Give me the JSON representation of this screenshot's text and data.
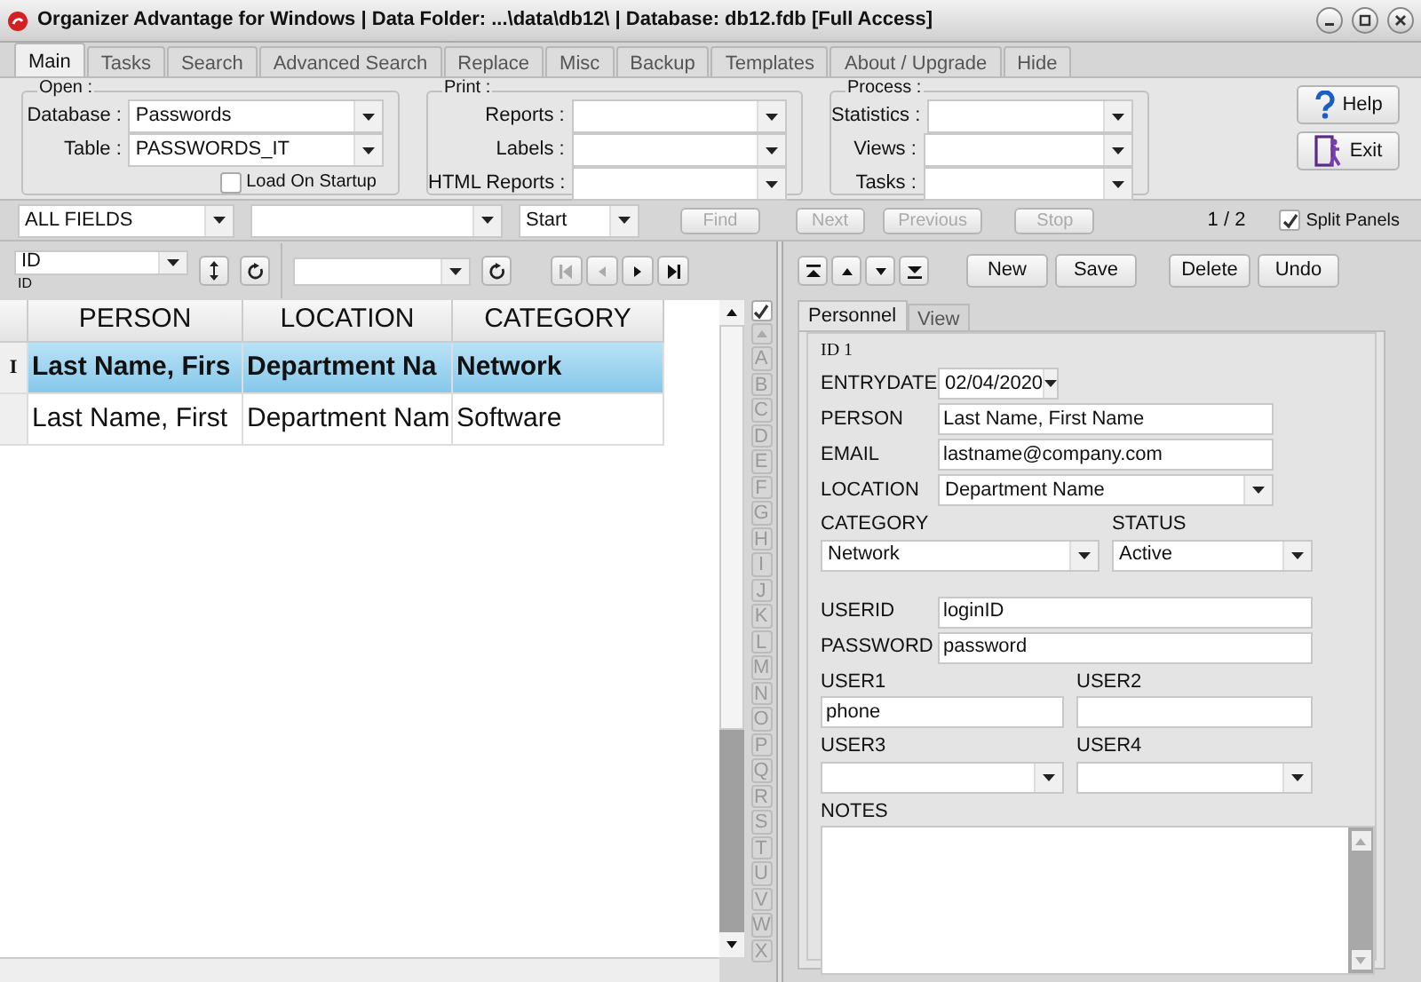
{
  "window": {
    "title": "Organizer Advantage for Windows | Data Folder: ...\\data\\db12\\ | Database: db12.fdb [Full Access]"
  },
  "tabs": [
    {
      "label": "Main",
      "selected": true
    },
    {
      "label": "Tasks",
      "selected": false
    },
    {
      "label": "Search",
      "selected": false
    },
    {
      "label": "Advanced Search",
      "selected": false
    },
    {
      "label": "Replace",
      "selected": false
    },
    {
      "label": "Misc",
      "selected": false
    },
    {
      "label": "Backup",
      "selected": false
    },
    {
      "label": "Templates",
      "selected": false
    },
    {
      "label": "About / Upgrade",
      "selected": false
    },
    {
      "label": "Hide",
      "selected": false
    }
  ],
  "groups": [
    {
      "legend": "Open :",
      "fields": [
        {
          "label": "Database :",
          "value": "Passwords"
        },
        {
          "label": "Table :",
          "value": "PASSWORDS_IT"
        }
      ],
      "checkbox": {
        "label": "Load On Startup",
        "checked": false
      }
    },
    {
      "legend": "Print :",
      "fields": [
        {
          "label": "Reports :"
        },
        {
          "label": "Labels :"
        },
        {
          "label": "HTML Reports :"
        }
      ]
    },
    {
      "legend": "Process :",
      "fields": [
        {
          "label": "Statistics :"
        },
        {
          "label": "Views :"
        },
        {
          "label": "Tasks :"
        }
      ]
    }
  ],
  "side_buttons": [
    {
      "kind": "help",
      "label": "Help"
    },
    {
      "kind": "exit",
      "label": "Exit"
    }
  ],
  "search": {
    "field": "ALL FIELDS",
    "mode": "Start",
    "buttons": [
      {
        "label": "Find",
        "disabled": true
      },
      {
        "label": "Next",
        "disabled": true
      },
      {
        "label": "Previous",
        "disabled": true
      },
      {
        "label": "Stop",
        "disabled": true
      }
    ],
    "counter": "1 / 2",
    "split_panels": {
      "label": "Split Panels",
      "checked": true
    }
  },
  "sort": {
    "field": "ID",
    "caption": "ID"
  },
  "record_nav": [
    {
      "kind": "first",
      "disabled": true
    },
    {
      "kind": "prev",
      "disabled": true
    },
    {
      "kind": "next",
      "disabled": false
    },
    {
      "kind": "last",
      "disabled": false
    }
  ],
  "grid": {
    "all_checked": true,
    "columns": [
      "PERSON",
      "LOCATION",
      "CATEGORY"
    ],
    "current_marker": "I",
    "rows": [
      {
        "cells": [
          "Last Name, Firs",
          "Department Na",
          "Network"
        ],
        "selected": true
      },
      {
        "cells": [
          "Last Name, First",
          "Department Nam",
          "Software"
        ],
        "selected": false
      }
    ],
    "letters": [
      "A",
      "B",
      "C",
      "D",
      "E",
      "F",
      "G",
      "H",
      "I",
      "J",
      "K",
      "L",
      "M",
      "N",
      "O",
      "P",
      "Q",
      "R",
      "S",
      "T",
      "U",
      "V",
      "W",
      "X"
    ]
  },
  "edit_buttons": [
    "New",
    "Save",
    "Delete",
    "Undo"
  ],
  "form_tabs": [
    {
      "label": "Personnel",
      "selected": true
    },
    {
      "label": "View",
      "selected": false
    }
  ],
  "form": {
    "id": "ID 1",
    "rows": [
      {
        "kind": "inline",
        "fields": [
          {
            "label": "ENTRYDATE",
            "kind": "date",
            "value": "02/04/2020"
          }
        ]
      },
      {
        "kind": "inline",
        "fields": [
          {
            "label": "PERSON",
            "kind": "text",
            "value": "Last Name, First Name"
          }
        ]
      },
      {
        "kind": "inline",
        "fields": [
          {
            "label": "EMAIL",
            "kind": "text",
            "value": "lastname@company.com"
          }
        ]
      },
      {
        "kind": "inline",
        "fields": [
          {
            "label": "LOCATION",
            "kind": "select",
            "value": "Department Name"
          }
        ]
      },
      {
        "kind": "pair",
        "fields": [
          {
            "label": "CATEGORY",
            "kind": "select",
            "value": "Network"
          },
          {
            "label": "STATUS",
            "kind": "select",
            "value": "Active"
          }
        ]
      },
      {
        "kind": "inline",
        "fields": [
          {
            "label": "USERID",
            "kind": "text",
            "value": "loginID"
          }
        ]
      },
      {
        "kind": "inline",
        "fields": [
          {
            "label": "PASSWORD",
            "kind": "text",
            "value": "password"
          }
        ]
      },
      {
        "kind": "pair",
        "fields": [
          {
            "label": "USER1",
            "kind": "text",
            "value": "phone"
          },
          {
            "label": "USER2",
            "kind": "text"
          }
        ]
      },
      {
        "kind": "pair",
        "fields": [
          {
            "label": "USER3",
            "kind": "select"
          },
          {
            "label": "USER4",
            "kind": "select"
          }
        ]
      },
      {
        "kind": "notes",
        "fields": [
          {
            "label": "NOTES",
            "kind": "memo"
          }
        ]
      }
    ]
  }
}
